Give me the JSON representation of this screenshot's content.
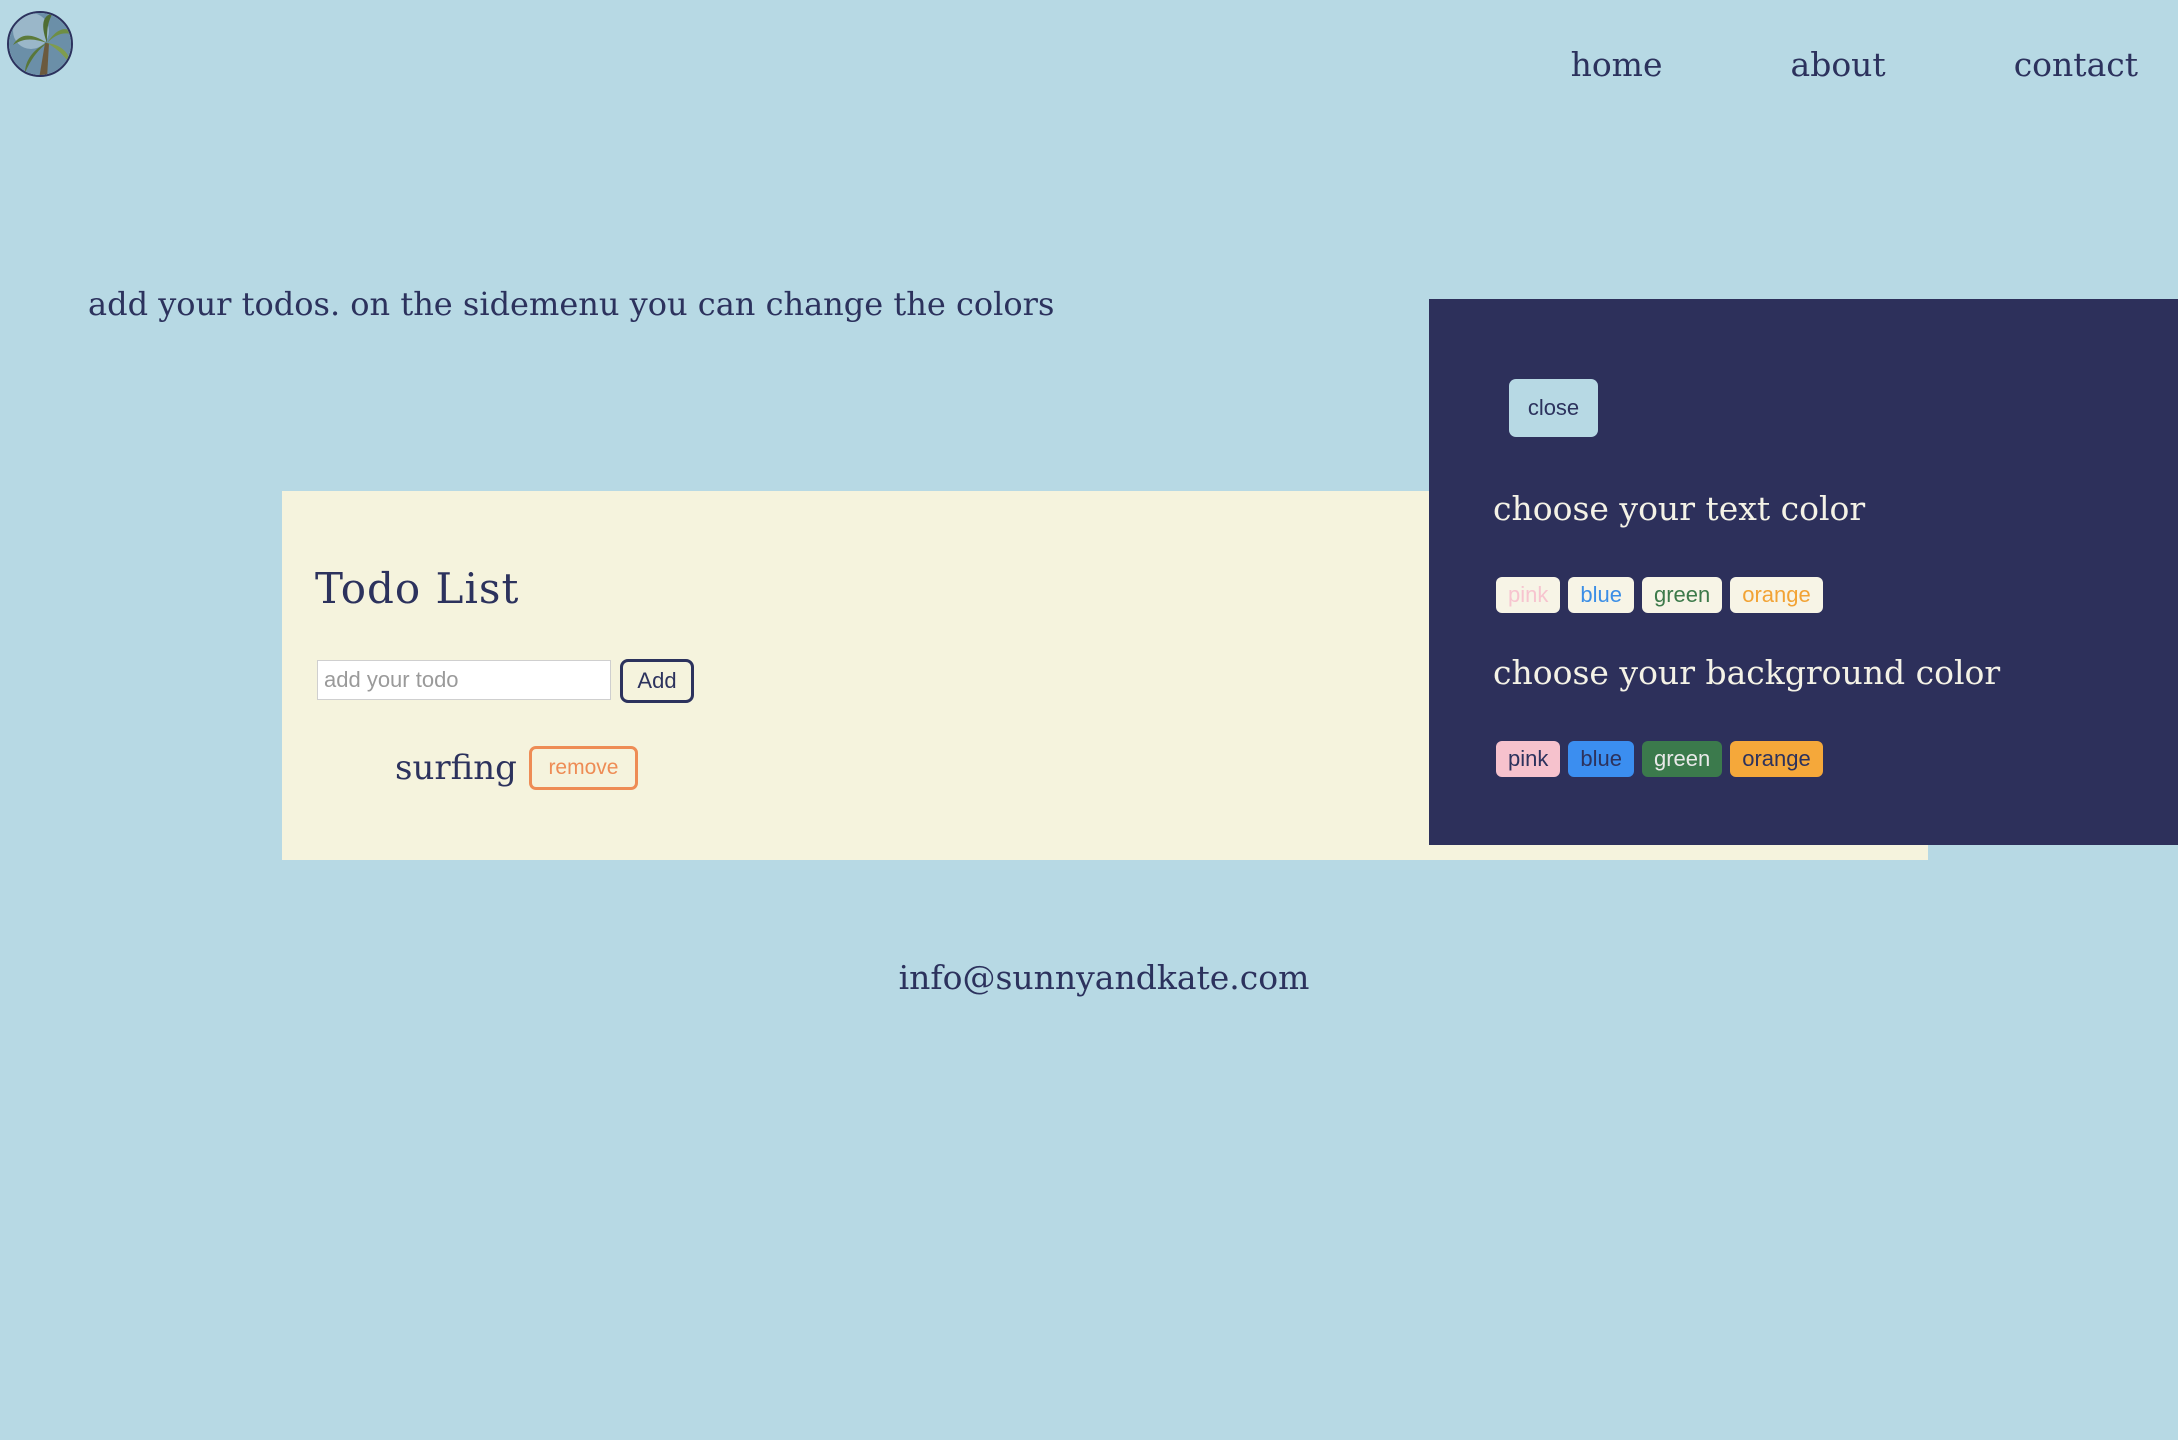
{
  "nav": {
    "home": "home",
    "about": "about",
    "contact": "contact"
  },
  "intro": "add your todos. on the sidemenu you can change the colors",
  "todo": {
    "title": "Todo List",
    "input_placeholder": "add your todo",
    "input_value": "",
    "add_label": "Add",
    "items": [
      {
        "text": "surfing",
        "remove_label": "remove"
      }
    ]
  },
  "sidemenu": {
    "close_label": "close",
    "text_color_heading": "choose your text color",
    "background_color_heading": "choose your background color",
    "text_colors": [
      {
        "label": "pink",
        "text": "#f7c4cf",
        "bg": "#f7f4e6"
      },
      {
        "label": "blue",
        "text": "#3b8ee6",
        "bg": "#f7f4e6"
      },
      {
        "label": "green",
        "text": "#3d7a4a",
        "bg": "#f7f4e6"
      },
      {
        "label": "orange",
        "text": "#f2a335",
        "bg": "#f7f4e6"
      }
    ],
    "background_colors": [
      {
        "label": "pink",
        "text": "#2c325d",
        "bg": "#f6c2cd"
      },
      {
        "label": "blue",
        "text": "#2c325d",
        "bg": "#3b8ef0"
      },
      {
        "label": "green",
        "text": "#e9e9e9",
        "bg": "#3b7a4c"
      },
      {
        "label": "orange",
        "text": "#2c325d",
        "bg": "#f5a83a"
      }
    ]
  },
  "footer": {
    "email": "info@sunnyandkate.com"
  },
  "colors": {
    "page_background": "#b7d9e4",
    "text": "#2c325d",
    "card_background": "#f5f3dd",
    "sidemenu_background": "#2d305b",
    "remove_accent": "#ee8c55"
  }
}
